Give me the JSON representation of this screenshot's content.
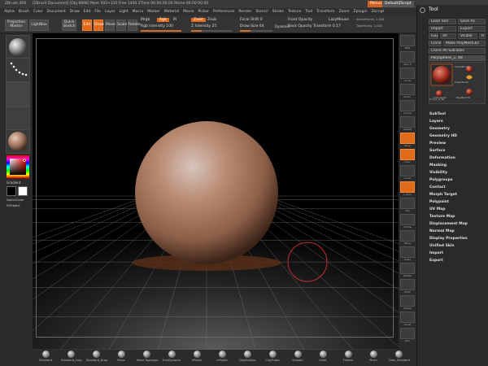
{
  "titlebar": {
    "title": "ZBrush 4R6",
    "doc_info": "[ZBrush Document]   [Obj 9898]  Mem 593+335  Free 1450  ZTime 00:00:00.00  Rtime 00:00:00.00",
    "menus_btn": "Menus",
    "script_btn": "DefaultZScript"
  },
  "menubar": {
    "items": [
      "Alpha",
      "Brush",
      "Color",
      "Document",
      "Draw",
      "Edit",
      "File",
      "Layer",
      "Light",
      "Macro",
      "Marker",
      "Material",
      "Movie",
      "Picker",
      "Preferences",
      "Render",
      "Stencil",
      "Stroke",
      "Texture",
      "Tool",
      "Transform",
      "Zoom",
      "Zplugin",
      "Zscript"
    ]
  },
  "toolbar": {
    "projection_master": "Projection Master",
    "lightbox": "LightBox",
    "quick_sketch": "Quick Sketch",
    "edit": "Edit",
    "draw": "Draw",
    "move": "Move",
    "scale": "Scale",
    "rotate": "Rotate",
    "mrgb": "Mrgb",
    "rgb": "Rgb",
    "m": "M",
    "rgb_intensity": "Rgb Intensity 100",
    "zadd": "Zadd",
    "zsub": "Zsub",
    "z_intensity": "Z Intensity 25",
    "focal_shift": "Focal Shift 0",
    "draw_size": "Draw Size 64",
    "dynamic": "Dynamic",
    "active_points": "ActivePoints: 2,048",
    "total_points": "TotalPoints: 2,048",
    "front_opacity": "Front Opacity",
    "back_opacity": "Back Opacity",
    "transform": "Transform 0.17",
    "lazymouse": "LazyMouse",
    "rgb_intensity_level": 100,
    "z_intensity_level": 25,
    "draw_size_level": 64
  },
  "leftshelf": {
    "material_caption": "",
    "stroke_caption": "",
    "alpha_caption": "",
    "texture_caption": "",
    "matcap_caption": "",
    "gradient": "Gradient",
    "switch_color": "SwitchColor",
    "fill_object": "FillObject"
  },
  "viewbar": {
    "items": [
      "BPR",
      "Spix 3",
      "Scroll",
      "Zoom",
      "Actual",
      "AAHalf",
      "Persp",
      "Floor",
      "Local",
      "L.Sym",
      "Xyz",
      "Frame",
      "Move",
      "Scale",
      "Rotate",
      "PolyF",
      "Transp",
      "Ghost",
      "Solo"
    ]
  },
  "toolpanel": {
    "title": "Tool",
    "load_tool": "Load Tool",
    "save_as": "Save As",
    "import": "Import",
    "export": "Export",
    "goz": "GoZ",
    "all": "All",
    "visible": "Visible",
    "r": "R",
    "clone": "Clone",
    "make_polymesh": "Make PolyMesh3D",
    "clone_all_subtools": "Clone All SubTools",
    "current_tool": "PolySphere_1. 48",
    "thumbs": [
      "PolySphere",
      "SimpleBrush",
      "EraserBrush",
      "Cylinder3D",
      "PolyMesh3D"
    ],
    "polysphere_label": "P_M_A_S_18",
    "sections": [
      "SubTool",
      "Layers",
      "Geometry",
      "Geometry HD",
      "Preview",
      "Surface",
      "Deformation",
      "Masking",
      "Visibility",
      "Polygroups",
      "Contact",
      "Morph Target",
      "Polypaint",
      "UV Map",
      "Texture Map",
      "Displacement Map",
      "Normal Map",
      "Display Properties",
      "Unified Skin",
      "Import",
      "Export"
    ]
  },
  "brushes": [
    "Standard",
    "Standard_Lazy",
    "Standard_Drop",
    "Move",
    "Move Topologic",
    "TrimDynamic",
    "hPolish",
    "mPolish",
    "ClayBuildup",
    "ClayTubes",
    "Smooth",
    "Inflat",
    "Flatten",
    "Pinch",
    "Dam_Standard"
  ],
  "colors": {
    "accent": "#e06a1a",
    "sphere": "#b98b73",
    "cursor_ring": "#c03030"
  }
}
